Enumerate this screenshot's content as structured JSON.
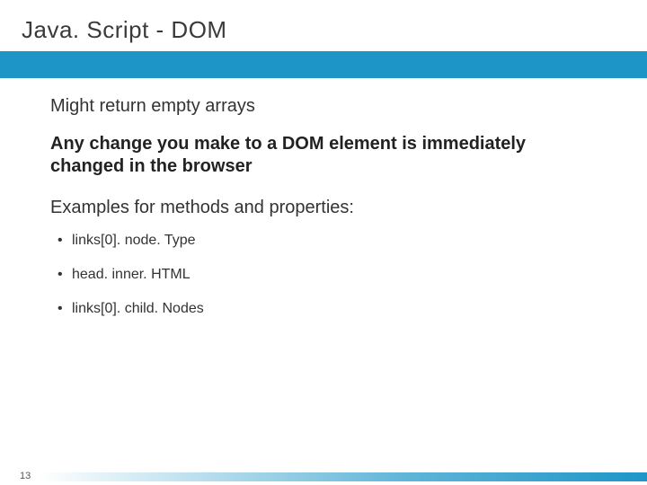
{
  "title": "Java. Script - DOM",
  "content": {
    "line1": "Might return empty arrays",
    "line2": "Any change you make to a DOM element is immediately changed in the browser",
    "line3": "Examples for methods and properties:",
    "bullets": [
      "links[0]. node. Type",
      "head. inner. HTML",
      "links[0]. child. Nodes"
    ]
  },
  "page_number": "13"
}
